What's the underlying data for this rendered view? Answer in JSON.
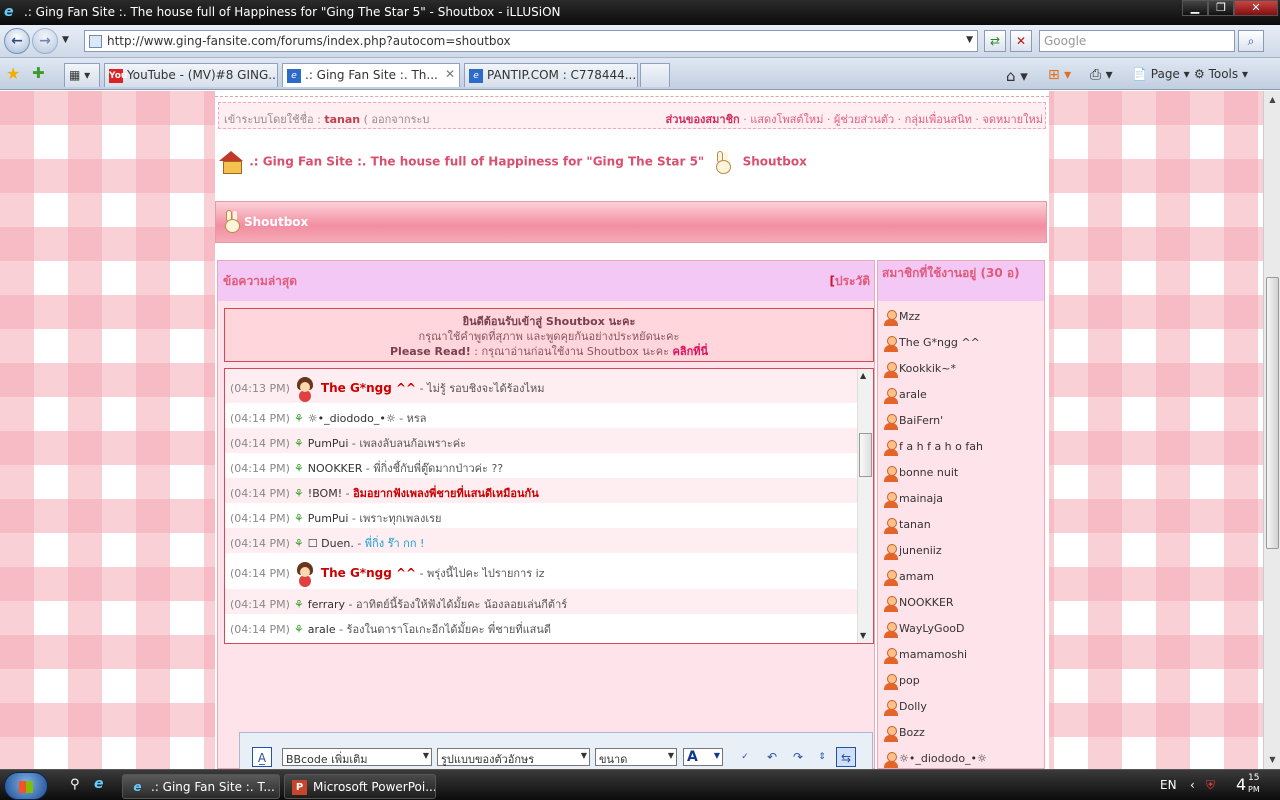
{
  "window": {
    "title": ".: Ging Fan Site :. The house full of Happiness for \"Ging The Star 5\" - Shoutbox - iLLUSiON",
    "min": "▁",
    "max": "❐",
    "close": "✕"
  },
  "address": {
    "url": "http://www.ging-fansite.com/forums/index.php?autocom=shoutbox",
    "search_placeholder": "Google"
  },
  "tabs": [
    {
      "label": "YouTube - (MV)#8 GING...",
      "icon": "You"
    },
    {
      "label": ".: Ging Fan Site :. Th...",
      "icon": "e"
    },
    {
      "label": "PANTIP.COM : C778444...",
      "icon": "e"
    }
  ],
  "toolbar": {
    "page": "Page",
    "tools": "Tools"
  },
  "login": {
    "prefix": "เข้าระบบโดยใช้ชื่อ :",
    "username": "tanan",
    "logout": "( ออกจากระบ",
    "member_area": "ส่วนของสมาชิก",
    "links": "· แสดงโพสต์ใหม่ · ผู้ช่วยส่วนตัว · กลุ่มเพื่อนสนิท · จดหมายใหม่"
  },
  "breadcrumb": {
    "site": ".: Ging Fan Site :. The house full of Happiness for \"Ging The Star 5\"",
    "page": "Shoutbox"
  },
  "shoutbox": {
    "title": "Shoutbox",
    "latest": "ข้อความล่าสุด",
    "history_open": "[",
    "history": "ประวัติ",
    "welcome1": "ยินดีต้อนรับเข้าสู่ Shoutbox นะคะ",
    "welcome2": "กรุณาใช้คำพูดที่สุภาพ และพูดคุยกันอย่างประหยัดนะคะ",
    "welcome3_bold": "Please Read!",
    "welcome3": " : กรุณาอ่านก่อนใช้งาน Shoutbox นะคะ ",
    "welcome3_link": "คลิกที่นี่"
  },
  "messages": [
    {
      "time": "(04:13 PM)",
      "user": "The G*ngg ^^",
      "text": " - ไม่รู้ รอบชิงจะได้ร้องไหม",
      "big": true
    },
    {
      "time": "(04:14 PM)",
      "user": "☼•_diododo_•☼",
      "text": " - หรล"
    },
    {
      "time": "(04:14 PM)",
      "user": "PumPui",
      "text": " - เพลงลับลนก้อเพราะค่ะ"
    },
    {
      "time": "(04:14 PM)",
      "user": "NOOKKER",
      "text": " - พี่กิ่งชี้กับพี่ตู๊ดมากป่าวค่ะ ??"
    },
    {
      "time": "(04:14 PM)",
      "user": "!BOM!",
      "text": " - ",
      "red": "อิมอยากฟังเพลงพี่ชายที่แสนดีเหมือนกัน"
    },
    {
      "time": "(04:14 PM)",
      "user": "PumPui",
      "text": " - เพราะทุกเพลงเรย"
    },
    {
      "time": "(04:14 PM)",
      "user": "☐ Duen.",
      "text": " - ",
      "cyan": "พี่กิ่ง ร๊า กก !"
    },
    {
      "time": "(04:14 PM)",
      "user": "The G*ngg ^^",
      "text": " - พรุ่งนี้ไปคะ ไปรายการ iz",
      "big": true
    },
    {
      "time": "(04:14 PM)",
      "user": "ferrary",
      "text": " - อาทิตย์นี้ร้องให้ฟังได้มั้ยคะ น้องลอยเล่นกีต้าร์"
    },
    {
      "time": "(04:14 PM)",
      "user": "arale",
      "text": " - ร้องในดาราโอเกะอีกได้มั้ยคะ พี่ชายที่แสนดี"
    }
  ],
  "online": {
    "title": "สมาชิกที่ใช้งานอยู่ (30 อ)",
    "users": [
      "Mzz",
      "The G*ngg ^^",
      "Kookkik~*",
      "arale",
      "BaiFern'",
      "f a h f a h o fah",
      "bonne nuit",
      "mainaja",
      "tanan",
      "juneniiz",
      "amam",
      "NOOKKER",
      "WayLyGooD",
      "mamamoshi",
      "pop",
      "Dolly",
      "Bozz",
      "☼•_diododo_•☼"
    ]
  },
  "editor": {
    "bbcode": "BBcode เพิ่มเติม",
    "font": "รูปแบบของตัวอักษร",
    "size": "ขนาด",
    "color_btn": "A"
  },
  "taskbar": {
    "tasks": [
      ".: Ging Fan Site :. T...",
      "Microsoft PowerPoi..."
    ],
    "lang": "EN",
    "time": "4",
    "time_small": "15",
    "ampm": "PM"
  }
}
